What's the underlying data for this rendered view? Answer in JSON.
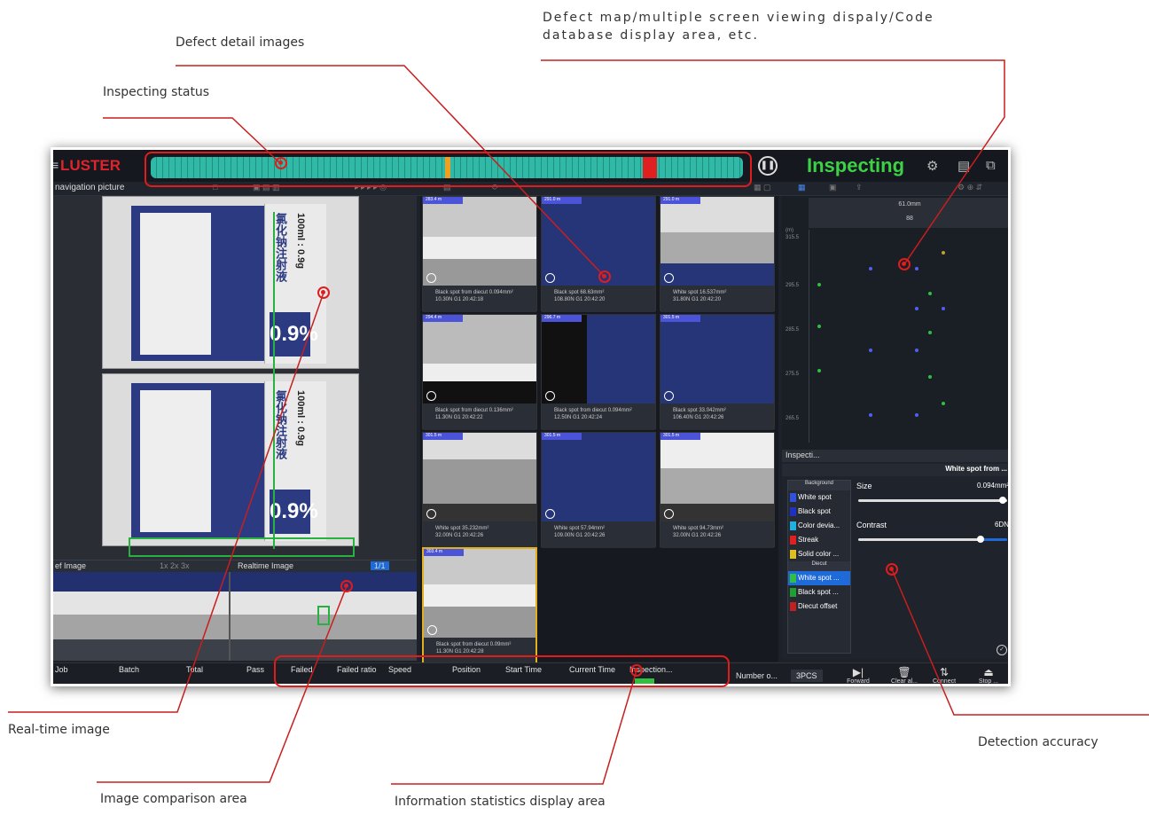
{
  "annotations": {
    "defect_map": "Defect map/multiple screen viewing dispaly/Code database display area, etc.",
    "defect_detail": "Defect detail images",
    "inspecting_status": "Inspecting status",
    "realtime_image": "Real-time image",
    "image_comparison": "Image comparison area",
    "info_stats": "Information statistics display area",
    "detection_accuracy": "Detection accuracy"
  },
  "app": {
    "logo": "LUSTER",
    "status": "Inspecting",
    "nav_title": "navigation picture",
    "label_product_cn": "氯化钠注射液",
    "label_volume": "100ml : 0.9g",
    "label_percent": "0.9%",
    "compare_left": "ef Image",
    "compare_zoom": "1x  2x  3x",
    "compare_right": "Realtime Image",
    "compare_page": "1/1"
  },
  "defects": [
    {
      "tag": "283.4 m",
      "caption": "Black spot from diecut  0.094mm²",
      "time": "10.30N G1  20:42:18"
    },
    {
      "tag": "291.0 m",
      "caption": "Black spot  68.63mm²",
      "time": "108.80N G1  20:42:20"
    },
    {
      "tag": "291.0 m",
      "caption": "White spot  16.537mm²",
      "time": "31.80N G1  20:42:20"
    },
    {
      "tag": "294.4 m",
      "caption": "Black spot from diecut  0.136mm²",
      "time": "11.30N G1  20:42:22"
    },
    {
      "tag": "296.7 m",
      "caption": "Black spot from diecut  0.094mm²",
      "time": "12.50N G1  20:42:24"
    },
    {
      "tag": "301.5 m",
      "caption": "Black spot  33.042mm²",
      "time": "106.40N G1  20:42:26"
    },
    {
      "tag": "301.5 m",
      "caption": "White spot  35.232mm²",
      "time": "32.00N G1  20:42:26"
    },
    {
      "tag": "301.5 m",
      "caption": "White spot  57.94mm²",
      "time": "109.00N G1  20:42:26"
    },
    {
      "tag": "301.5 m",
      "caption": "White spot  94.73mm²",
      "time": "32.00N G1  20:42:26"
    },
    {
      "tag": "303.4 m",
      "caption": "Black spot from diecut  0.09mm²",
      "time": "11.30N G1  20:42:28"
    }
  ],
  "map": {
    "header_top": "61.0mm",
    "header_bottom": "88",
    "y_unit": "(m)",
    "y_ticks": [
      "315.5",
      "295.5",
      "285.5",
      "275.5",
      "265.5"
    ]
  },
  "panel": {
    "title": "Inspecti...",
    "selected": "White spot from ...",
    "group_background": "Background",
    "group_diecut": "Diecut",
    "items": [
      "White spot",
      "Black spot",
      "Color devia...",
      "Streak",
      "Solid color ..."
    ],
    "items_diecut": [
      "White spot ...",
      "Black spot ...",
      "Diecut offset"
    ],
    "size_label": "Size",
    "size_value": "0.094mm²",
    "contrast_label": "Contrast",
    "contrast_value": "6DN",
    "size_level": 0.97,
    "contrast_level": 0.82
  },
  "footer": {
    "headers": [
      "Job",
      "Batch",
      "Total",
      "Pass",
      "Failed",
      "Failed ratio",
      "Speed",
      "Position",
      "Start Time",
      "Current Time",
      "Inspection..."
    ],
    "number_label": "Number o...",
    "number_value": "3PCS",
    "buttons": [
      "Forward t...",
      "Clear al...",
      "Connect",
      "Stop ..."
    ]
  },
  "colors": {
    "status_green": "#3ed046",
    "logo_red": "#e2232b",
    "defect_red": "#e02020",
    "accent_blue": "#1e6ad8"
  }
}
